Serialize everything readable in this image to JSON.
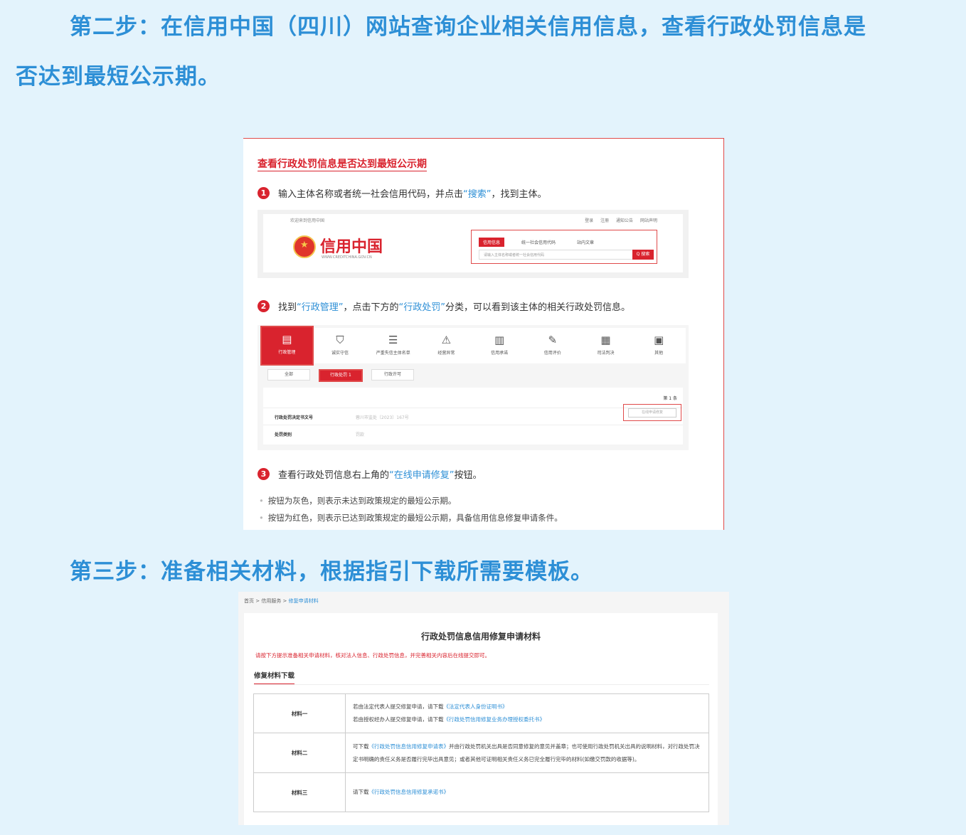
{
  "step2_heading_line1": "第二步：在信用中国（四川）网站查询企业相关信用信息，查看行政处罚信息是",
  "step2_heading_line2": "否达到最短公示期。",
  "step3_heading": "第三步：准备相关材料，根据指引下载所需要模板。",
  "card1": {
    "title": "查看行政处罚信息是否达到最短公示期",
    "step1": {
      "num": "1",
      "pre": "输入主体名称或者统一社会信用代码，并点击",
      "hl": "“搜索”",
      "post": "，找到主体。"
    },
    "step2": {
      "num": "2",
      "pre": "找到",
      "hl1": "“行政管理”",
      "mid": "，点击下方的",
      "hl2": "“行政处罚”",
      "post": "分类，可以看到该主体的相关行政处罚信息。"
    },
    "step3": {
      "num": "3",
      "pre": "查看行政处罚信息右上角的",
      "hl": "“在线申请修复”",
      "post": "按钮。"
    },
    "note1": "按钮为灰色，则表示未达到政策规定的最短公示期。",
    "note2": "按钮为红色，则表示已达到政策规定的最短公示期，具备信用信息修复申请条件。",
    "site": {
      "welcome": "欢迎来到信用中国",
      "links": [
        "登录",
        "注册",
        "通知公告",
        "网站声明"
      ],
      "logo": "信用中国",
      "url": "WWW.CREDITCHINA.GOV.CN",
      "tabs": [
        "信用信息",
        "统一社会信用代码",
        "站内文章"
      ],
      "placeholder": "请输入主体名称或者统一社会信用代码",
      "search_btn": "Q 搜索"
    },
    "categories": [
      "行政管理",
      "诚实守信",
      "严重失信主体名单",
      "经营异常",
      "信用承诺",
      "信用评价",
      "司法判决",
      "其他"
    ],
    "subtabs": [
      "全部",
      "行政处罚 1",
      "行政许可"
    ],
    "result": {
      "count": "第 1 条",
      "row1_key": "行政处罚决定书文号",
      "row1_val": "蓉川市监处〔2023〕167号",
      "row2_key": "处罚类别",
      "row2_val": "罚款",
      "repair": "在线申请修复"
    }
  },
  "card2": {
    "crumb": [
      "首页",
      "信用服务",
      "修复申请材料"
    ],
    "title": "行政处罚信息信用修复申请材料",
    "warning": "请按下方提示准备相关申请材料，核对法人信息、行政处罚信息，并完善相关内容后在线提交即可。",
    "section": "修复材料下载",
    "rows": [
      {
        "label": "材料一",
        "l1_pre": "若由法定代表人提交修复申请，请下载",
        "l1_link": "《法定代表人身份证明书》",
        "l2_pre": "若由授权经办人提交修复申请，请下载",
        "l2_link": "《行政处罚信用修复业务办理授权委托书》"
      },
      {
        "label": "材料二",
        "pre": "可下载",
        "link": "《行政处罚信息信用修复申请表》",
        "post": "并由行政处罚机关出具是否同意修复的意见并盖章；也可使用行政处罚机关出具的说明材料，对行政处罚决定书明确的责任义务是否履行完毕出具意见；或者其他可证明相关责任义务已完全履行完毕的材料(如缴交罚款的收据等)。"
      },
      {
        "label": "材料三",
        "pre": "请下载",
        "link": "《行政处罚信息信用修复承诺书》"
      }
    ]
  }
}
